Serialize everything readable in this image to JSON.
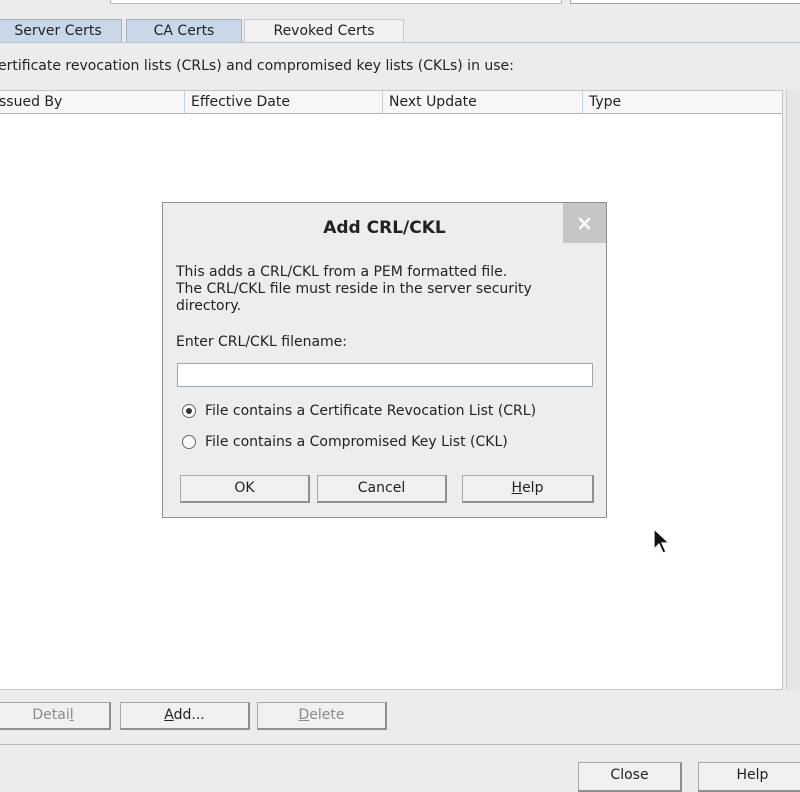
{
  "tabs": [
    {
      "label": "Server Certs"
    },
    {
      "label": "CA Certs"
    },
    {
      "label": "Revoked Certs"
    }
  ],
  "description": "ertificate revocation lists (CRLs) and compromised key lists (CKLs) in use:",
  "table": {
    "columns": [
      "ssued By",
      "Effective Date",
      "Next Update",
      "Type"
    ],
    "rows": []
  },
  "actions": {
    "detail_pre": "Detai",
    "detail_mn": "l",
    "detail_post": "",
    "add_pre": "",
    "add_mn": "A",
    "add_post": "dd...",
    "delete_pre": "",
    "delete_mn": "D",
    "delete_post": "elete"
  },
  "footer": {
    "close": "Close",
    "help": "Help"
  },
  "dialog": {
    "title": "Add CRL/CKL",
    "close_glyph": "×",
    "message": "This adds a CRL/CKL from a PEM formatted file.\nThe CRL/CKL file must reside in the server security\ndirectory.",
    "field_label": "Enter CRL/CKL filename:",
    "field_value": "",
    "options": [
      {
        "label": "File contains a Certificate Revocation List (CRL)",
        "selected": true
      },
      {
        "label": "File contains a Compromised Key List (CKL)",
        "selected": false
      }
    ],
    "ok": "OK",
    "cancel": "Cancel",
    "help_pre": "",
    "help_mn": "H",
    "help_post": "elp"
  }
}
